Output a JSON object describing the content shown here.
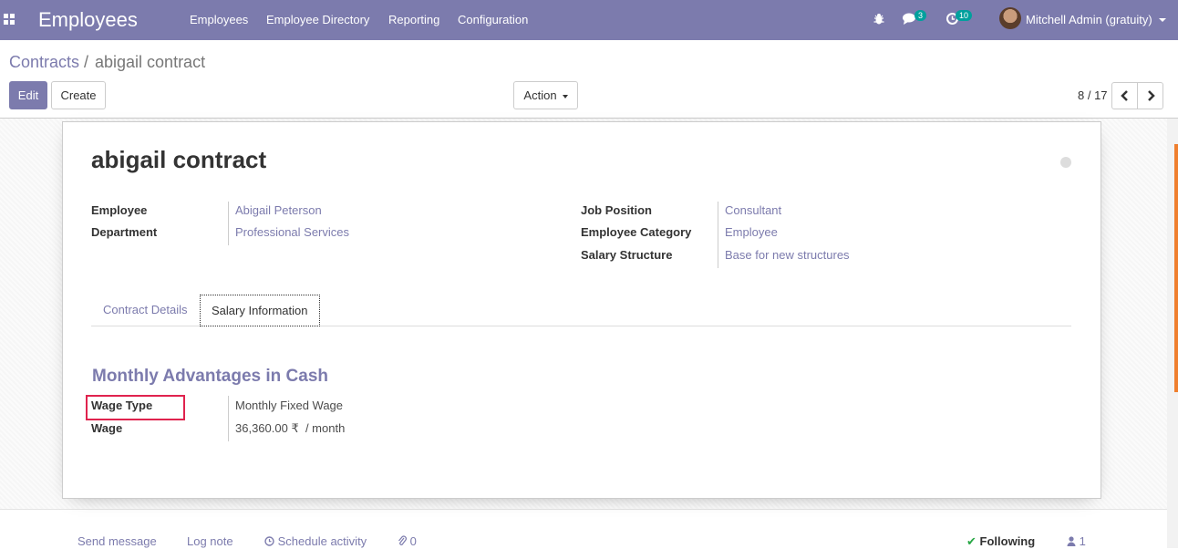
{
  "topbar": {
    "app_name": "Employees",
    "menu": [
      "Employees",
      "Employee Directory",
      "Reporting",
      "Configuration"
    ],
    "messages_badge": "3",
    "activities_badge": "10",
    "user_name": "Mitchell Admin (gratuity)"
  },
  "breadcrumb": {
    "parent": "Contracts",
    "separator": "/",
    "current": "abigail contract"
  },
  "toolbar": {
    "edit_label": "Edit",
    "create_label": "Create",
    "action_label": "Action"
  },
  "pager": {
    "value": "8 / 17"
  },
  "record": {
    "title": "abigail contract",
    "left_fields": [
      {
        "label": "Employee",
        "value": "Abigail Peterson"
      },
      {
        "label": "Department",
        "value": "Professional Services"
      }
    ],
    "right_fields": [
      {
        "label": "Job Position",
        "value": "Consultant"
      },
      {
        "label": "Employee Category",
        "value": "Employee"
      },
      {
        "label": "Salary Structure",
        "value": "Base for new structures"
      }
    ]
  },
  "tabs": [
    {
      "label": "Contract Details",
      "active": false
    },
    {
      "label": "Salary Information",
      "active": true
    }
  ],
  "salary": {
    "section_title": "Monthly Advantages in Cash",
    "fields": [
      {
        "label": "Wage Type",
        "value": "Monthly Fixed Wage"
      },
      {
        "label": "Wage",
        "value": "36,360.00 ₹  / month"
      }
    ]
  },
  "chatter": {
    "send_message": "Send message",
    "log_note": "Log note",
    "schedule_activity": "Schedule activity",
    "attachments_count": "0",
    "following": "Following",
    "followers_count": "1"
  },
  "colors": {
    "brand": "#7c7bad",
    "highlight_box": "#e0234e",
    "badge": "#00a09d"
  }
}
